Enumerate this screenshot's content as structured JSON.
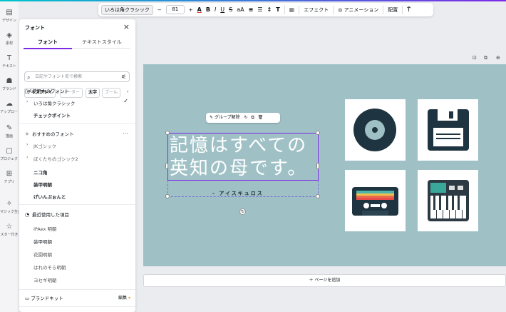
{
  "rail": [
    {
      "icon": "design-icon",
      "glyph": "▤",
      "label": "デザイン"
    },
    {
      "icon": "elements-icon",
      "glyph": "◈",
      "label": "素材"
    },
    {
      "icon": "text-icon",
      "glyph": "T",
      "label": "テキスト"
    },
    {
      "icon": "brand-icon",
      "glyph": "☗",
      "label": "ブランド"
    },
    {
      "icon": "upload-icon",
      "glyph": "☁",
      "label": "アップロード"
    },
    {
      "icon": "draw-icon",
      "glyph": "✎",
      "label": "描画"
    },
    {
      "icon": "projects-icon",
      "glyph": "▢",
      "label": "プロジェクト"
    },
    {
      "icon": "apps-icon",
      "glyph": "⊞",
      "label": "アプリ"
    },
    {
      "icon": "magic-icon",
      "glyph": "✧",
      "label": "マジック生成"
    },
    {
      "icon": "star-icon",
      "glyph": "☆",
      "label": "スター付き"
    }
  ],
  "toolbar": {
    "font": "いろは角クラシック",
    "minus": "−",
    "size": "81",
    "plus": "+",
    "text_color": "A",
    "bold": "B",
    "italic": "I",
    "underline": "U",
    "strike": "S",
    "case": "aA",
    "align": "≡",
    "list": "☰",
    "spacing": "↕",
    "vertical": "T",
    "effect": "エフェクト",
    "animation": "アニメーション",
    "position": "配置",
    "paint": "⍑"
  },
  "panel": {
    "title": "フォント",
    "close": "×",
    "tabs": [
      "フォント",
      "テキストスタイル"
    ],
    "search_placeholder": "日記やフォント名で検索",
    "chips": [
      "ディスプレイ",
      "ルーター",
      "太字",
      "ブール",
      "›"
    ],
    "recent_title": "使用中のフォント",
    "recent": [
      "いろは角クラシック",
      "チェックポイント"
    ],
    "recommended_title": "おすすめのフォント",
    "recommended": [
      "JKゴシック",
      "ぼくたちのゴシック2",
      "ニコ角",
      "装甲明朝",
      "げいんぷぉんと"
    ],
    "history_title": "最近使用した項目",
    "history": [
      "IPAex 明朝",
      "装甲明朝",
      "花園明朝",
      "はれのそら明朝",
      "ヨセギ明朝"
    ],
    "brand_kit": "ブランドキット",
    "brand_edit": "編集"
  },
  "canvas": {
    "group_bar": "グループ解除",
    "quote_line1": "記憶はすべての",
    "quote_line2": "英知の母です。",
    "author": "- アイスキュロス"
  },
  "add_page": "＋ ページを追加",
  "colors": {
    "canvas_bg": "#9fc1c6",
    "accent": "#7d2ae8"
  }
}
